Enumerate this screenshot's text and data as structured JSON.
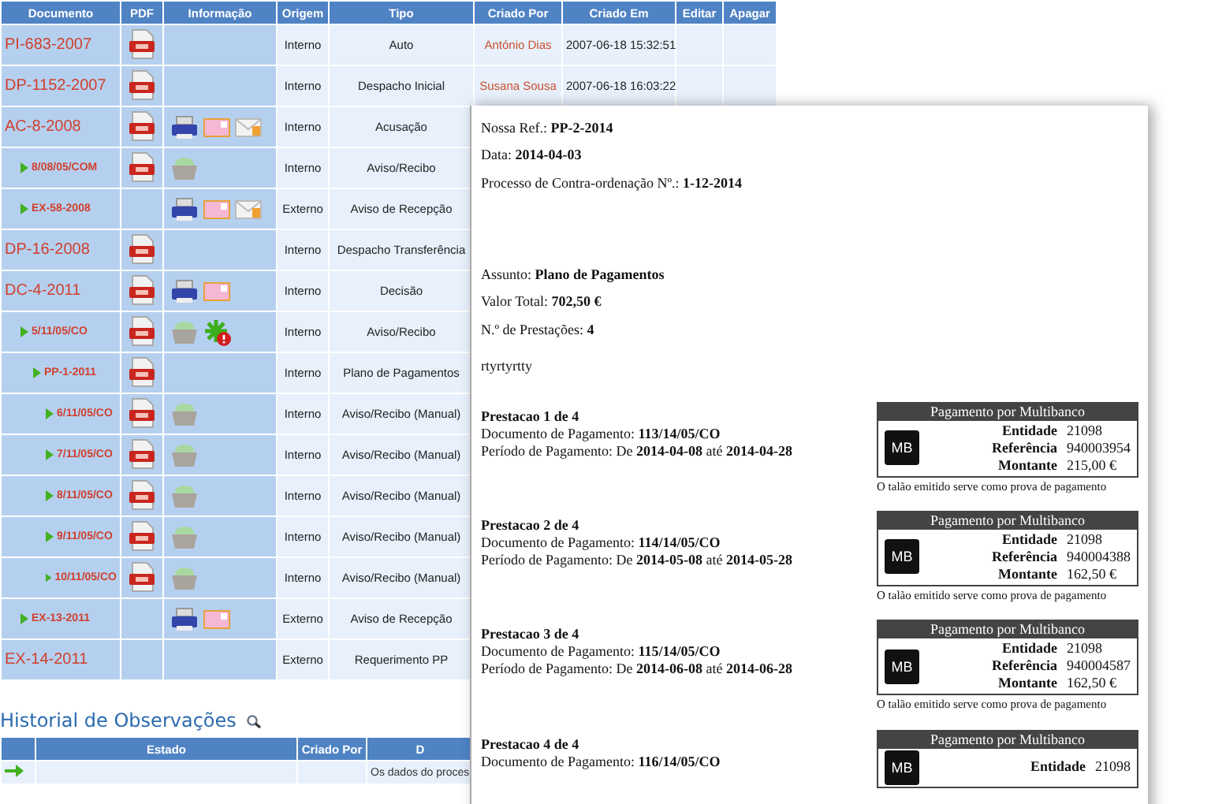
{
  "documents_table": {
    "columns": [
      "Documento",
      "PDF",
      "Informação",
      "Origem",
      "Tipo",
      "Criado Por",
      "Criado Em",
      "Editar",
      "Apagar"
    ],
    "rows": [
      {
        "document": "PI-683-2007",
        "pdf": true,
        "origem": "Interno",
        "tipo": "Auto",
        "criado_por": "António Dias",
        "criado_em": "2007-06-18 15:32:51"
      },
      {
        "document": "DP-1152-2007",
        "pdf": true,
        "origem": "Interno",
        "tipo": "Despacho Inicial",
        "criado_por": "Susana Sousa",
        "criado_em": "2007-06-18 16:03:22"
      },
      {
        "document": "AC-8-2008",
        "pdf": true,
        "info": [
          {
            "kind": "printer"
          },
          {
            "kind": "postcard"
          },
          {
            "kind": "envelope"
          }
        ],
        "origem": "Interno",
        "tipo": "Acusação",
        "children": [
          {
            "document": "8/08/05/COM",
            "pdf": true,
            "info": [
              {
                "kind": "money-bag"
              }
            ],
            "origem": "Interno",
            "tipo": "Aviso/Recibo"
          },
          {
            "document": "EX-58-2008",
            "pdf": false,
            "info": [
              {
                "kind": "printer"
              },
              {
                "kind": "postcard"
              },
              {
                "kind": "envelope"
              }
            ],
            "origem": "Externo",
            "tipo": "Aviso de Recepção"
          }
        ]
      },
      {
        "document": "DP-16-2008",
        "pdf": true,
        "origem": "Interno",
        "tipo": "Despacho Transferência"
      },
      {
        "document": "DC-4-2011",
        "pdf": true,
        "info": [
          {
            "kind": "printer"
          },
          {
            "kind": "postcard"
          }
        ],
        "origem": "Interno",
        "tipo": "Decisão",
        "children": [
          {
            "document": "5/11/05/CO",
            "pdf": true,
            "info": [
              {
                "kind": "money-bag"
              },
              {
                "kind": "alert"
              }
            ],
            "origem": "Interno",
            "tipo": "Aviso/Recibo",
            "children": [
              {
                "document": "PP-1-2011",
                "pdf": true,
                "origem": "Interno",
                "tipo": "Plano de Pagamentos",
                "children": [
                  {
                    "document": "6/11/05/CO",
                    "pdf": true,
                    "info": [
                      {
                        "kind": "money-bag"
                      }
                    ],
                    "origem": "Interno",
                    "tipo": "Aviso/Recibo (Manual)"
                  },
                  {
                    "document": "7/11/05/CO",
                    "pdf": true,
                    "info": [
                      {
                        "kind": "money-bag"
                      }
                    ],
                    "origem": "Interno",
                    "tipo": "Aviso/Recibo (Manual)"
                  },
                  {
                    "document": "8/11/05/CO",
                    "pdf": true,
                    "info": [
                      {
                        "kind": "money-bag"
                      }
                    ],
                    "origem": "Interno",
                    "tipo": "Aviso/Recibo (Manual)"
                  },
                  {
                    "document": "9/11/05/CO",
                    "pdf": true,
                    "info": [
                      {
                        "kind": "money-bag"
                      }
                    ],
                    "origem": "Interno",
                    "tipo": "Aviso/Recibo (Manual)"
                  },
                  {
                    "document": "10/11/05/CO",
                    "pdf": true,
                    "info": [
                      {
                        "kind": "money-bag"
                      }
                    ],
                    "origem": "Interno",
                    "tipo": "Aviso/Recibo (Manual)"
                  }
                ]
              }
            ]
          },
          {
            "document": "EX-13-2011",
            "pdf": false,
            "info": [
              {
                "kind": "printer"
              },
              {
                "kind": "postcard"
              }
            ],
            "origem": "Externo",
            "tipo": "Aviso de Recepção"
          }
        ]
      },
      {
        "document": "EX-14-2011",
        "pdf": false,
        "origem": "Externo",
        "tipo": "Requerimento PP"
      }
    ]
  },
  "history": {
    "title": "Historial de Observações",
    "columns": [
      "Estado",
      "Criado Por",
      "D"
    ],
    "rows": [
      {
        "description": "Os dados do proces"
      }
    ]
  },
  "document_preview": {
    "header_lines": [
      {
        "label": "Nossa Ref.:",
        "value": "PP-2-2014"
      },
      {
        "label": "Data:",
        "value": "2014-04-03"
      },
      {
        "label": "Processo de Contra-ordenação Nº.:",
        "value": "1-12-2014"
      }
    ],
    "summary_lines": [
      {
        "label": "Assunto:",
        "value": "Plano de Pagamentos"
      },
      {
        "label": "Valor Total:",
        "value": "702,50 €"
      },
      {
        "label": "N.º de Prestações:",
        "value": "4"
      }
    ],
    "note": "rtyrtyrtty",
    "installments": [
      {
        "title": "Prestacao 1 de 4",
        "lines": [
          "Documento de Pagamento: **113/14/05/CO**",
          "Período de Pagamento: De **2014-04-08** até **2014-04-28**"
        ],
        "box": {
          "title": "Pagamento por Multibanco",
          "logo": "MB",
          "fields": [
            {
              "label": "Entidade",
              "value": "21098"
            },
            {
              "label": "Referência",
              "value": "940003954"
            },
            {
              "label": "Montante",
              "value": "215,00 €"
            }
          ],
          "footer": "O talão emitido serve como prova de pagamento"
        }
      },
      {
        "title": "Prestacao 2 de 4",
        "lines": [
          "Documento de Pagamento: **114/14/05/CO**",
          "Período de Pagamento: De **2014-05-08** até **2014-05-28**"
        ],
        "box": {
          "title": "Pagamento por Multibanco",
          "logo": "MB",
          "fields": [
            {
              "label": "Entidade",
              "value": "21098"
            },
            {
              "label": "Referência",
              "value": "940004388"
            },
            {
              "label": "Montante",
              "value": "162,50 €"
            }
          ],
          "footer": "O talão emitido serve como prova de pagamento"
        }
      },
      {
        "title": "Prestacao 3 de 4",
        "lines": [
          "Documento de Pagamento: **115/14/05/CO**",
          "Período de Pagamento: De **2014-06-08** até **2014-06-28**"
        ],
        "box": {
          "title": "Pagamento por Multibanco",
          "logo": "MB",
          "fields": [
            {
              "label": "Entidade",
              "value": "21098"
            },
            {
              "label": "Referência",
              "value": "940004587"
            },
            {
              "label": "Montante",
              "value": "162,50 €"
            }
          ],
          "footer": "O talão emitido serve como prova de pagamento"
        }
      },
      {
        "title": "Prestacao 4 de 4",
        "lines": [
          "Documento de Pagamento: **116/14/05/CO**"
        ],
        "box": {
          "title": "Pagamento por Multibanco",
          "logo": "MB",
          "fields": [
            {
              "label": "Entidade",
              "value": "21098"
            }
          ]
        }
      }
    ]
  }
}
